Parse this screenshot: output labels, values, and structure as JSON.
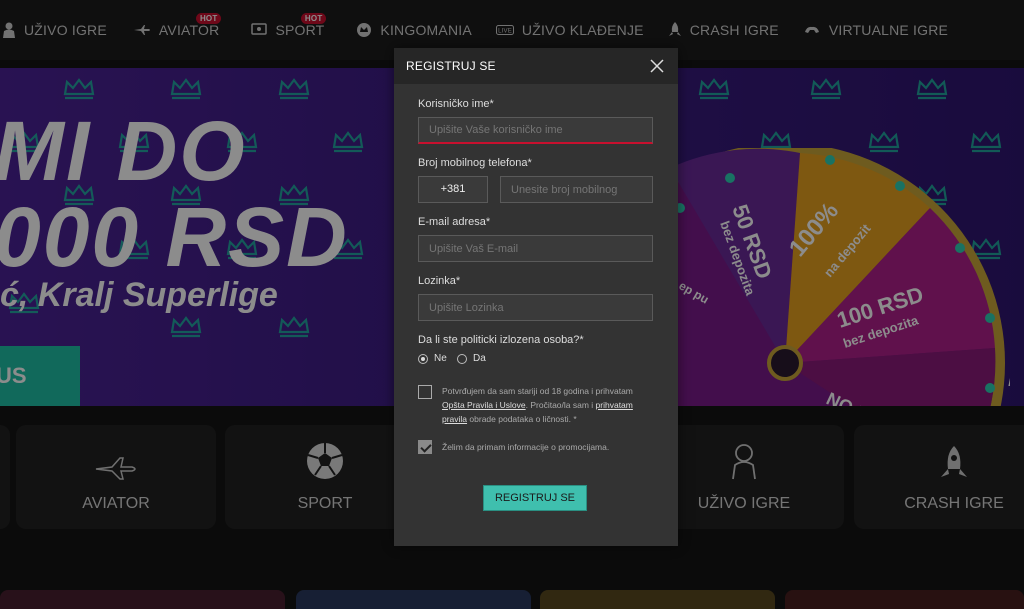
{
  "nav": {
    "items": [
      {
        "label": "UŽIVO IGRE",
        "icon": "live-dealer-icon"
      },
      {
        "label": "AVIATOR",
        "icon": "airplane-icon",
        "badge": "HOT"
      },
      {
        "label": "SPORT",
        "icon": "sport-icon",
        "badge": "HOT"
      },
      {
        "label": "KINGOMANIA",
        "icon": "kingomania-icon"
      },
      {
        "label": "UŽIVO KLAĐENJE",
        "icon": "live-betting-icon"
      },
      {
        "label": "CRASH IGRE",
        "icon": "rocket-icon"
      },
      {
        "label": "VIRTUALNE IGRE",
        "icon": "virtual-games-icon"
      }
    ]
  },
  "hero": {
    "line1": "MI DO",
    "line2": "000 RSD",
    "line3": "ć, Kralj Superlige",
    "button": "US",
    "wheel": {
      "segments": [
        "50 RSD bez depozita",
        "100% na depozit",
        "100 RSD bez depozita",
        "NO B",
        "ep pu"
      ],
      "edge_text": "r"
    }
  },
  "tiles": [
    {
      "label": "AVIATOR",
      "icon": "airplane-icon"
    },
    {
      "label": "SPORT",
      "icon": "soccer-ball-icon"
    },
    {
      "label": "UŽIVO IGRE",
      "icon": "live-dealer-icon"
    },
    {
      "label": "CRASH IGRE",
      "icon": "rocket-icon"
    }
  ],
  "modal": {
    "title": "REGISTRUJ SE",
    "username": {
      "label": "Korisničko ime*",
      "placeholder": "Upišite Vaše korisničko ime"
    },
    "phone": {
      "label": "Broj mobilnog telefona*",
      "prefix": "+381",
      "placeholder": "Unesite broj mobilnog"
    },
    "email": {
      "label": "E-mail adresa*",
      "placeholder": "Upišite Vaš E-mail"
    },
    "password": {
      "label": "Lozinka*",
      "placeholder": "Upišite Lozinka"
    },
    "pep": {
      "label": "Da li ste politicki izlozena osoba?*",
      "options": [
        "Ne",
        "Da"
      ],
      "selected": "Ne"
    },
    "terms": {
      "text1": "Potvrđujem da sam stariji od 18 godina i prihvatam ",
      "link1": "Opšta Pravila i Uslove",
      "text2": ". Pročitao/la sam i ",
      "link2": "prihvatam pravila",
      "text3": " obrade podataka o ličnosti. *",
      "checked": false
    },
    "promo": {
      "text": "Želim da primam informacije o promocijama.",
      "checked": true
    },
    "submit": "REGISTRUJ SE"
  },
  "colors": {
    "accent": "#3fbfae",
    "error": "#c8102e",
    "hero_bg": "#3e1d85"
  }
}
